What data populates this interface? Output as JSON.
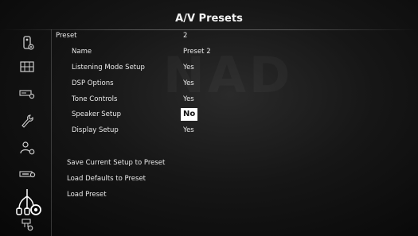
{
  "header": {
    "title": "A/V Presets"
  },
  "watermark": {
    "text": "NAD"
  },
  "sidebar": {
    "items": [
      {
        "icon": "remote-icon"
      },
      {
        "icon": "speaker-grid-icon"
      },
      {
        "icon": "amplifier-settings-icon"
      },
      {
        "icon": "wrench-icon"
      },
      {
        "icon": "user-settings-icon"
      },
      {
        "icon": "device-settings-icon"
      },
      {
        "icon": "av-cables-settings-icon",
        "active": true
      },
      {
        "icon": "source-settings-icon"
      }
    ]
  },
  "preset": {
    "label": "Preset",
    "value": "2",
    "fields": [
      {
        "label": "Name",
        "value": "Preset 2"
      },
      {
        "label": "Listening Mode Setup",
        "value": "Yes"
      },
      {
        "label": "DSP Options",
        "value": "Yes"
      },
      {
        "label": "Tone Controls",
        "value": "Yes"
      },
      {
        "label": "Speaker Setup",
        "value": "No",
        "selected": true
      },
      {
        "label": "Display Setup",
        "value": "Yes"
      }
    ]
  },
  "actions": [
    {
      "label": "Save Current Setup to Preset"
    },
    {
      "label": "Load Defaults to Preset"
    },
    {
      "label": "Load Preset"
    }
  ]
}
